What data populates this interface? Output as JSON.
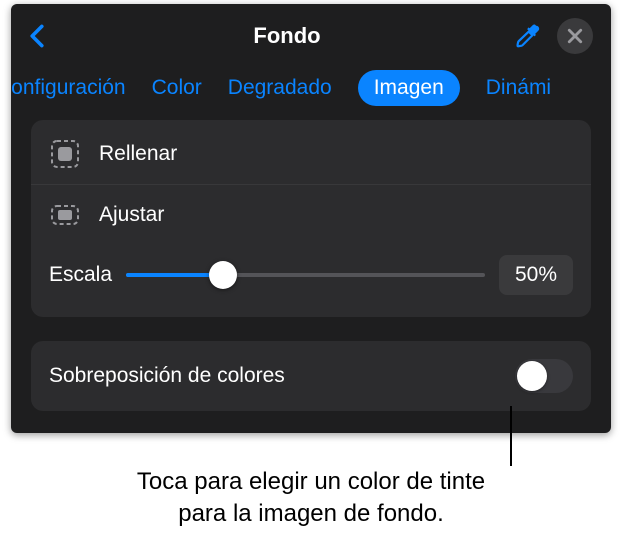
{
  "header": {
    "title": "Fondo"
  },
  "tabs": {
    "items": [
      {
        "label": "econfiguración",
        "active": false
      },
      {
        "label": "Color",
        "active": false
      },
      {
        "label": "Degradado",
        "active": false
      },
      {
        "label": "Imagen",
        "active": true
      },
      {
        "label": "Dinámi",
        "active": false
      }
    ]
  },
  "fillModes": {
    "fill": "Rellenar",
    "fit": "Ajustar"
  },
  "scale": {
    "label": "Escala",
    "value": "50%",
    "percent": 27
  },
  "overlay": {
    "label": "Sobreposición de colores",
    "on": false
  },
  "callout": {
    "line1": "Toca para elegir un color de tinte",
    "line2": "para la imagen de fondo."
  }
}
